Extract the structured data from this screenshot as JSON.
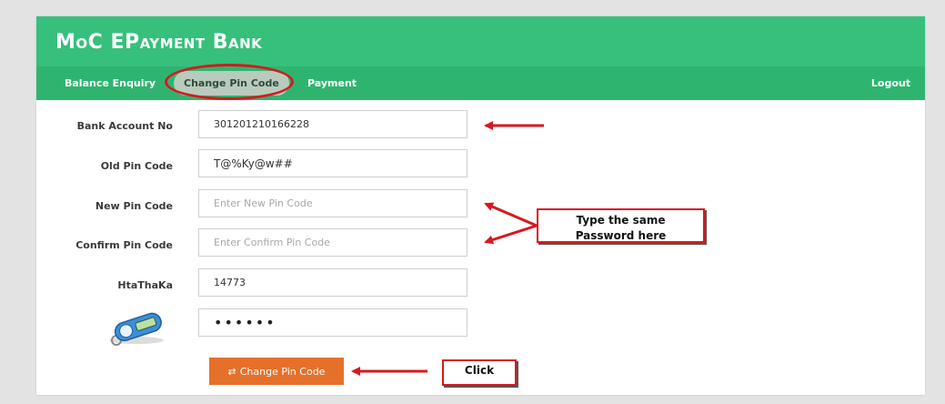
{
  "app": {
    "title": "MoC EPayment Bank"
  },
  "nav": {
    "balance": "Balance Enquiry",
    "change_pin": "Change Pin Code",
    "payment": "Payment",
    "logout": "Logout"
  },
  "form": {
    "account_label": "Bank Account No",
    "account_value": "301201210166228",
    "old_pin_label": "Old Pin Code",
    "old_pin_value": "T@%Ky@w##",
    "new_pin_label": "New Pin Code",
    "new_pin_placeholder": "Enter New Pin Code",
    "confirm_pin_label": "Confirm Pin Code",
    "confirm_pin_placeholder": "Enter Confirm Pin Code",
    "htathaka_label": "HtaThaKa",
    "htathaka_value": "14773",
    "token_value": "••••••",
    "submit_label": "Change Pin Code",
    "submit_icon": "swap-arrows-icon"
  },
  "annotations": {
    "same_password_line1": "Type the same",
    "same_password_line2": "Password here",
    "click": "Click",
    "color": "#d6191f"
  },
  "colors": {
    "brand_green": "#36c07c",
    "nav_green": "#2fb470",
    "button_orange": "#e5702a"
  }
}
